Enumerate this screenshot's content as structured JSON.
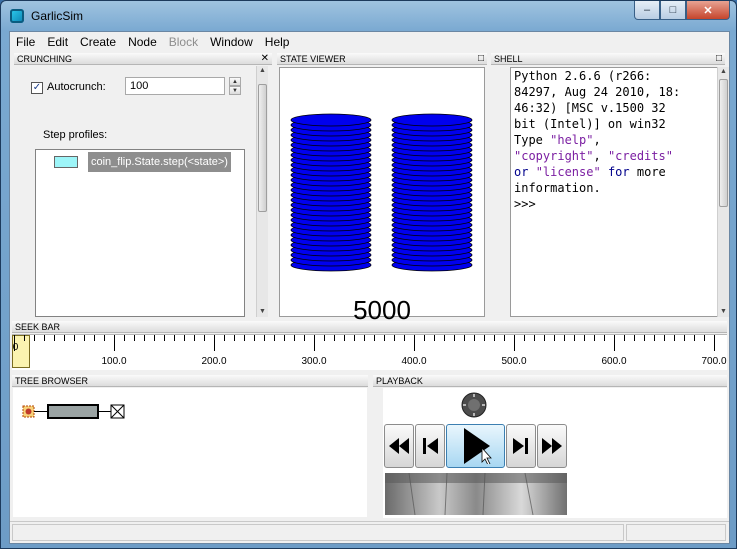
{
  "window": {
    "title": "GarlicSim",
    "minimize": "–",
    "maximize": "□",
    "close": "✕"
  },
  "menu": [
    "File",
    "Edit",
    "Create",
    "Node",
    "Block",
    "Window",
    "Help"
  ],
  "menu_disabled": [
    "Block"
  ],
  "crunching": {
    "title": "CRUNCHING",
    "close_glyph": "✕",
    "autocrunch_label": "Autocrunch:",
    "autocrunch_checked": true,
    "autocrunch_value": "100",
    "step_profiles_label": "Step profiles:",
    "profiles": [
      {
        "color": "#9df5f8",
        "name": "coin_flip.State.step(<state>)"
      }
    ]
  },
  "state_viewer": {
    "title": "STATE VIEWER",
    "maximize_glyph": "□",
    "value": "5000",
    "coin_color": "#0000ee"
  },
  "shell": {
    "title": "SHELL",
    "maximize_glyph": "□",
    "lines": [
      "Python 2.6.6 (r266:",
      "84297, Aug 24 2010, 18:",
      "46:32) [MSC v.1500 32",
      "bit (Intel)] on win32",
      "Type \"help\",",
      "\"copyright\", \"credits\"",
      "or \"license\" for more",
      "information.",
      ">>>"
    ]
  },
  "seek_bar": {
    "title": "SEEK BAR",
    "labels": [
      "100.0",
      "200.0",
      "300.0",
      "400.0",
      "500.0",
      "600.0",
      "700.0"
    ],
    "cursor_label": ".0",
    "cursor_color": "#fbf3b0"
  },
  "tree_browser": {
    "title": "TREE BROWSER"
  },
  "playback": {
    "title": "PLAYBACK",
    "buttons": [
      "rewind",
      "previous",
      "play",
      "next",
      "fast-forward"
    ]
  }
}
